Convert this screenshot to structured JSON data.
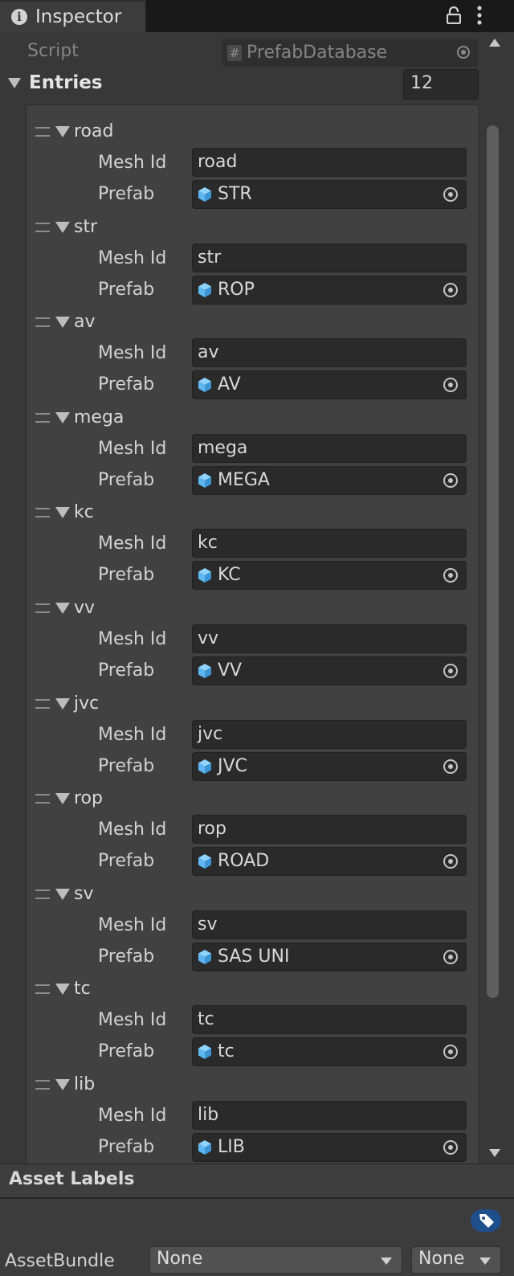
{
  "window": {
    "tab_title": "Inspector",
    "tab_icon": "info-icon"
  },
  "header": {
    "lock_icon": "lock-icon",
    "menu_icon": "more-vertical-icon"
  },
  "script_field": {
    "label": "Script",
    "value": "PrefabDatabase",
    "icon": "hash-script-icon"
  },
  "entries": {
    "label": "Entries",
    "count": "12",
    "mesh_id_label": "Mesh Id",
    "prefab_label": "Prefab",
    "items": [
      {
        "title": "road",
        "mesh_id": "road",
        "prefab": "STR"
      },
      {
        "title": "str",
        "mesh_id": "str",
        "prefab": "ROP"
      },
      {
        "title": "av",
        "mesh_id": "av",
        "prefab": "AV"
      },
      {
        "title": "mega",
        "mesh_id": "mega",
        "prefab": "MEGA"
      },
      {
        "title": "kc",
        "mesh_id": "kc",
        "prefab": "KC"
      },
      {
        "title": "vv",
        "mesh_id": "vv",
        "prefab": "VV"
      },
      {
        "title": "jvc",
        "mesh_id": "jvc",
        "prefab": "JVC"
      },
      {
        "title": "rop",
        "mesh_id": "rop",
        "prefab": "ROAD"
      },
      {
        "title": "sv",
        "mesh_id": "sv",
        "prefab": "SAS UNI"
      },
      {
        "title": "tc",
        "mesh_id": "tc",
        "prefab": "tc"
      },
      {
        "title": "lib",
        "mesh_id": "lib",
        "prefab": "LIB"
      }
    ]
  },
  "asset_labels": {
    "title": "Asset Labels",
    "tag_icon": "tag-icon",
    "asset_bundle_label": "AssetBundle",
    "bundle_value": "None",
    "variant_value": "None"
  },
  "colors": {
    "background": "#383838",
    "field": "#2a2a2a",
    "prefab_icon": "#5eb7f0",
    "tag_button": "#1f4e8c"
  }
}
